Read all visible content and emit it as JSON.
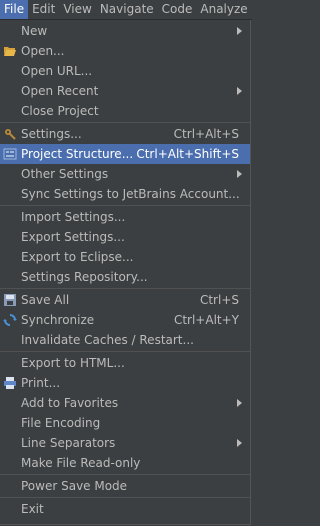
{
  "menubar": {
    "items": [
      "File",
      "Edit",
      "View",
      "Navigate",
      "Code",
      "Analyze"
    ]
  },
  "menu": {
    "groups": [
      [
        {
          "label": "New",
          "submenu": true
        },
        {
          "label": "Open...",
          "icon": "open-folder-icon"
        },
        {
          "label": "Open URL..."
        },
        {
          "label": "Open Recent",
          "submenu": true
        },
        {
          "label": "Close Project"
        }
      ],
      [
        {
          "label": "Settings...",
          "shortcut": "Ctrl+Alt+S",
          "icon": "settings-wrench-icon"
        },
        {
          "label": "Project Structure...",
          "shortcut": "Ctrl+Alt+Shift+S",
          "icon": "project-structure-icon",
          "highlighted": true
        },
        {
          "label": "Other Settings",
          "submenu": true
        },
        {
          "label": "Sync Settings to JetBrains Account..."
        }
      ],
      [
        {
          "label": "Import Settings..."
        },
        {
          "label": "Export Settings..."
        },
        {
          "label": "Export to Eclipse..."
        },
        {
          "label": "Settings Repository..."
        }
      ],
      [
        {
          "label": "Save All",
          "shortcut": "Ctrl+S",
          "icon": "save-icon"
        },
        {
          "label": "Synchronize",
          "shortcut": "Ctrl+Alt+Y",
          "icon": "synchronize-icon"
        },
        {
          "label": "Invalidate Caches / Restart..."
        }
      ],
      [
        {
          "label": "Export to HTML..."
        },
        {
          "label": "Print...",
          "icon": "print-icon"
        },
        {
          "label": "Add to Favorites",
          "submenu": true
        },
        {
          "label": "File Encoding"
        },
        {
          "label": "Line Separators",
          "submenu": true
        },
        {
          "label": "Make File Read-only"
        }
      ],
      [
        {
          "label": "Power Save Mode"
        }
      ],
      [
        {
          "label": "Exit"
        }
      ]
    ]
  },
  "colors": {
    "menu_bg": "#3c3f41",
    "highlight": "#4b6eaf",
    "text": "#bbbbbb"
  }
}
